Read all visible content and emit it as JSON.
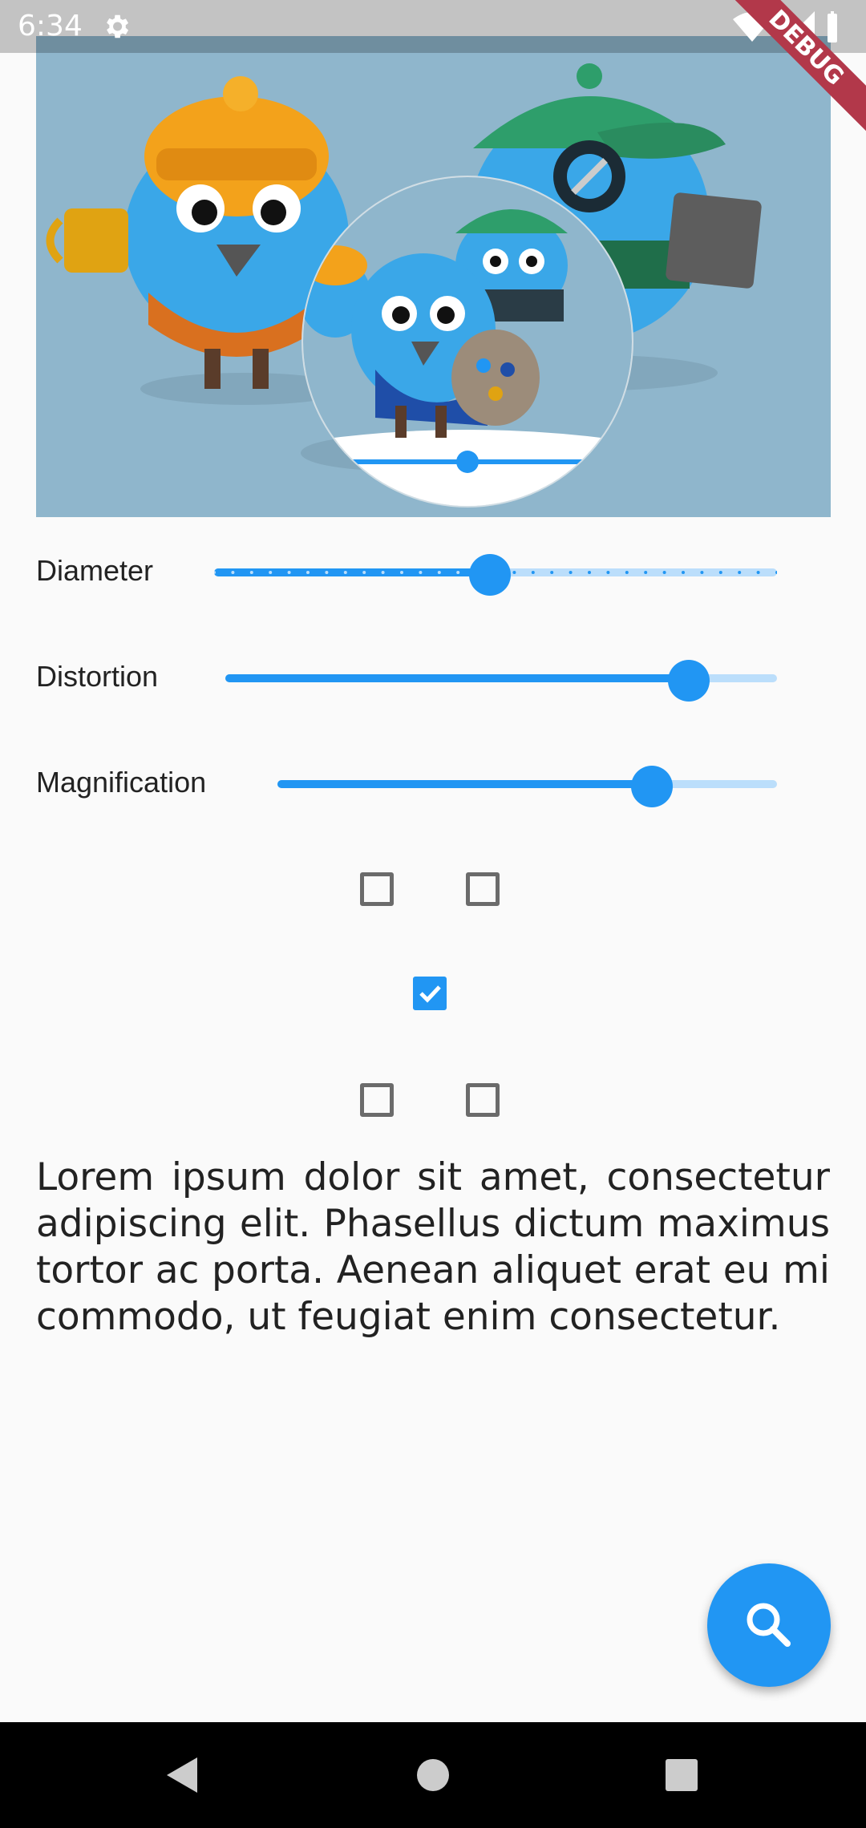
{
  "status_bar": {
    "time": "6:34",
    "icons": [
      "settings-icon",
      "wifi-icon",
      "signal-icon",
      "battery-icon"
    ]
  },
  "debug_banner": "DEBUG",
  "image": {
    "description_icon": "birds-illustration",
    "background_color": "#8fb6cc"
  },
  "sliders": [
    {
      "label": "Diameter",
      "value": 0.49,
      "discrete": true
    },
    {
      "label": "Distortion",
      "value": 0.84,
      "discrete": false
    },
    {
      "label": "Magnification",
      "value": 0.75,
      "discrete": false
    }
  ],
  "checkboxes": {
    "top_left": false,
    "top_right": false,
    "center": true,
    "bottom_left": false,
    "bottom_right": false
  },
  "paragraph": "Lorem ipsum dolor sit amet, consectetur adipiscing elit. Phasellus dictum maximus tortor ac porta. Aenean aliquet erat eu mi commodo, ut feugiat enim consectetur.",
  "fab": {
    "icon": "search-icon"
  },
  "accent_color": "#2196f3",
  "navbar": {
    "icons": [
      "back-icon",
      "home-icon",
      "recents-icon"
    ]
  }
}
